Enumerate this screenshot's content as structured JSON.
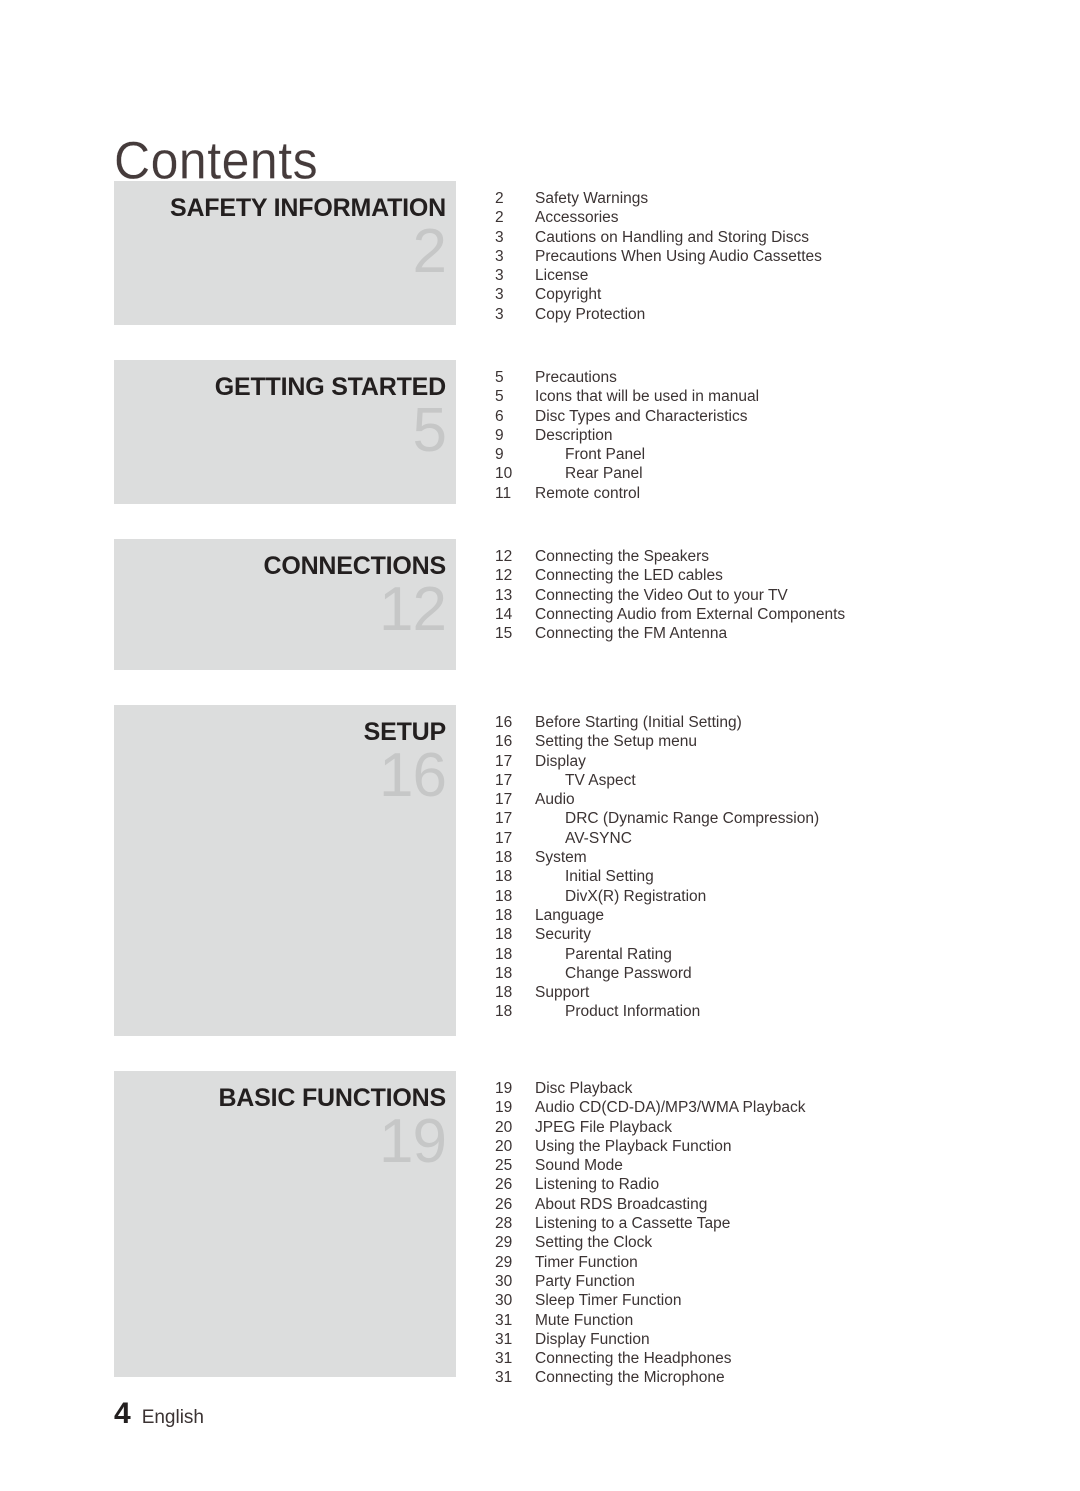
{
  "document": {
    "title": "Contents"
  },
  "footer": {
    "page_number": "4",
    "language": "English"
  },
  "sections": [
    {
      "name": "SAFETY INFORMATION",
      "number": "2",
      "banner_height": 144,
      "entries": [
        {
          "page": "2",
          "label": "Safety Warnings",
          "indent": 0
        },
        {
          "page": "2",
          "label": "Accessories",
          "indent": 0
        },
        {
          "page": "3",
          "label": "Cautions on Handling and Storing Discs",
          "indent": 0
        },
        {
          "page": "3",
          "label": "Precautions When Using Audio Cassettes",
          "indent": 0
        },
        {
          "page": "3",
          "label": "License",
          "indent": 0
        },
        {
          "page": "3",
          "label": "Copyright",
          "indent": 0
        },
        {
          "page": "3",
          "label": "Copy Protection",
          "indent": 0
        }
      ]
    },
    {
      "name": "GETTING STARTED",
      "number": "5",
      "banner_height": 144,
      "entries": [
        {
          "page": "5",
          "label": "Precautions",
          "indent": 0
        },
        {
          "page": "5",
          "label": "Icons that will be used in manual",
          "indent": 0
        },
        {
          "page": "6",
          "label": "Disc Types and Characteristics",
          "indent": 0
        },
        {
          "page": "9",
          "label": "Description",
          "indent": 0
        },
        {
          "page": "9",
          "label": "Front Panel",
          "indent": 1
        },
        {
          "page": "10",
          "label": "Rear Panel",
          "indent": 1
        },
        {
          "page": "11",
          "label": "Remote control",
          "indent": 0
        }
      ]
    },
    {
      "name": "CONNECTIONS",
      "number": "12",
      "banner_height": 131,
      "entries": [
        {
          "page": "12",
          "label": "Connecting the Speakers",
          "indent": 0
        },
        {
          "page": "12",
          "label": "Connecting the LED cables",
          "indent": 0
        },
        {
          "page": "13",
          "label": "Connecting the Video Out to your TV",
          "indent": 0
        },
        {
          "page": "14",
          "label": "Connecting Audio from External Components",
          "indent": 0
        },
        {
          "page": "15",
          "label": "Connecting the FM Antenna",
          "indent": 0
        }
      ]
    },
    {
      "name": "SETUP",
      "number": "16",
      "banner_height": 331,
      "entries": [
        {
          "page": "16",
          "label": "Before Starting (Initial Setting)",
          "indent": 0
        },
        {
          "page": "16",
          "label": "Setting the Setup menu",
          "indent": 0
        },
        {
          "page": "17",
          "label": "Display",
          "indent": 0
        },
        {
          "page": "17",
          "label": "TV Aspect",
          "indent": 1
        },
        {
          "page": "17",
          "label": "Audio",
          "indent": 0
        },
        {
          "page": "17",
          "label": "DRC (Dynamic Range Compression)",
          "indent": 1
        },
        {
          "page": "17",
          "label": "AV-SYNC",
          "indent": 1
        },
        {
          "page": "18",
          "label": "System",
          "indent": 0
        },
        {
          "page": "18",
          "label": "Initial Setting",
          "indent": 1
        },
        {
          "page": "18",
          "label": "DivX(R) Registration",
          "indent": 1
        },
        {
          "page": "18",
          "label": "Language",
          "indent": 0
        },
        {
          "page": "18",
          "label": "Security",
          "indent": 0
        },
        {
          "page": "18",
          "label": "Parental Rating",
          "indent": 1
        },
        {
          "page": "18",
          "label": "Change Password",
          "indent": 1
        },
        {
          "page": "18",
          "label": "Support",
          "indent": 0
        },
        {
          "page": "18",
          "label": "Product Information",
          "indent": 1
        }
      ]
    },
    {
      "name": "BASIC FUNCTIONS",
      "number": "19",
      "banner_height": 306,
      "entries": [
        {
          "page": "19",
          "label": "Disc Playback",
          "indent": 0
        },
        {
          "page": "19",
          "label": "Audio CD(CD-DA)/MP3/WMA Playback",
          "indent": 0
        },
        {
          "page": "20",
          "label": "JPEG File Playback",
          "indent": 0
        },
        {
          "page": "20",
          "label": "Using the Playback Function",
          "indent": 0
        },
        {
          "page": "25",
          "label": "Sound Mode",
          "indent": 0
        },
        {
          "page": "26",
          "label": "Listening to Radio",
          "indent": 0
        },
        {
          "page": "26",
          "label": "About RDS Broadcasting",
          "indent": 0
        },
        {
          "page": "28",
          "label": "Listening to a Cassette Tape",
          "indent": 0
        },
        {
          "page": "29",
          "label": "Setting the Clock",
          "indent": 0
        },
        {
          "page": "29",
          "label": "Timer Function",
          "indent": 0
        },
        {
          "page": "30",
          "label": "Party Function",
          "indent": 0
        },
        {
          "page": "30",
          "label": "Sleep Timer Function",
          "indent": 0
        },
        {
          "page": "31",
          "label": "Mute Function",
          "indent": 0
        },
        {
          "page": "31",
          "label": "Display Function",
          "indent": 0
        },
        {
          "page": "31",
          "label": "Connecting the Headphones",
          "indent": 0
        },
        {
          "page": "31",
          "label": "Connecting the Microphone",
          "indent": 0
        }
      ]
    }
  ]
}
